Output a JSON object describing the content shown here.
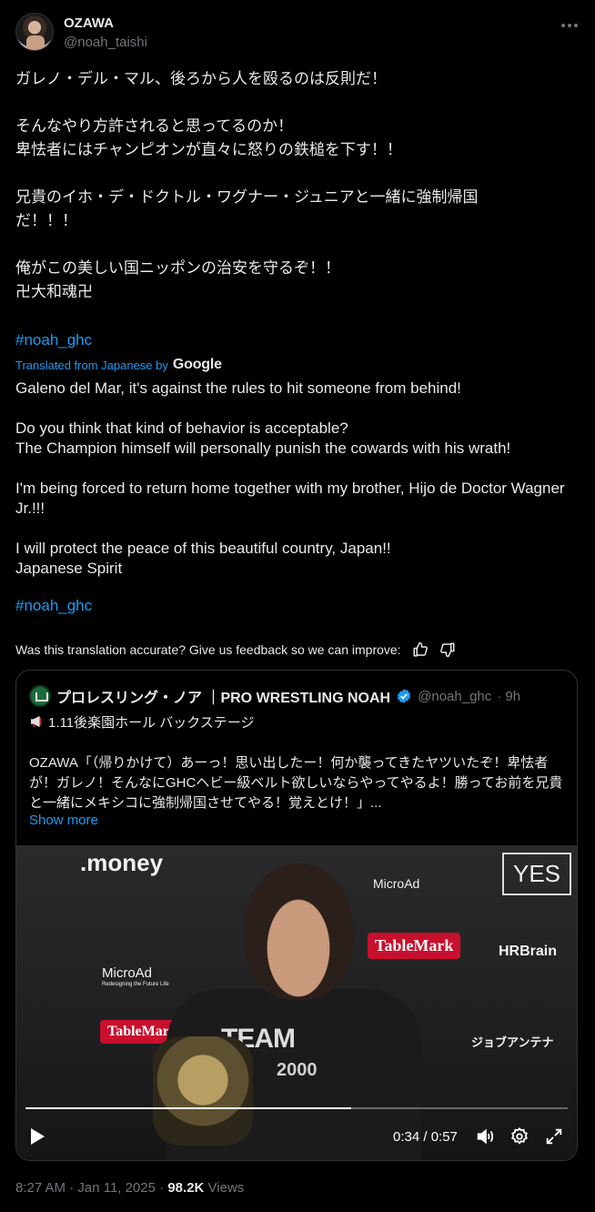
{
  "author": {
    "display_name": "OZAWA",
    "handle": "@noah_taishi"
  },
  "tweet": {
    "text_ja": "ガレノ・デル・マル、後ろから人を殴るのは反則だ！\n\nそんなやり方許されると思ってるのか！\n卑怯者にはチャンピオンが直々に怒りの鉄槌を下す！！\n\n兄貴のイホ・デ・ドクトル・ワグナー・ジュニアと一緒に強制帰国\nだ！！！\n\n俺がこの美しい国ニッポンの治安を守るぞ！！\n卍大和魂卍",
    "hashtag": "#noah_ghc",
    "translated_label": "Translated from Japanese by",
    "translator": "Google",
    "text_en": "Galeno del Mar, it's against the rules to hit someone from behind!\n\nDo you think that kind of behavior is acceptable?\nThe Champion himself will personally punish the cowards with his wrath!\n\nI'm being forced to return home together with my brother, Hijo de Doctor Wagner Jr.!!!\n\nI will protect the peace of this beautiful country, Japan!!\nJapanese Spirit",
    "hashtag_en": "#noah_ghc",
    "feedback_prompt": "Was this translation accurate? Give us feedback so we can improve:"
  },
  "quote": {
    "name": "プロレスリング・ノア ｜PRO WRESTLING NOAH",
    "handle": "@noah_ghc",
    "time": "· 9h",
    "title_line": "1.11後楽園ホール バックステージ",
    "body": "OZAWA「（帰りかけて）あーっ！思い出したー！何か襲ってきたヤツいたぞ！卑怯者が！ガレノ！そんなにGHCヘビー級ベルト欲しいならやってやるよ！勝ってお前を兄貴と一緒にメキシコに強制帰国させてやる！覚えとけ！」...",
    "show_more": "Show more",
    "video": {
      "time_display": "0:34 / 0:57",
      "progress": 0.6,
      "backdrop_logos": [
        ".money",
        "MicroAd",
        "YES",
        "TableMark",
        "HRBrain",
        "MicroAd",
        "TableMark",
        "ジョブアンテナ",
        "Redesigning the Future Life",
        "TEAM",
        "2000"
      ]
    }
  },
  "meta": {
    "time": "8:27 AM · Jan 11, 2025",
    "separator": "·",
    "views_count": "98.2K",
    "views_label": "Views"
  },
  "icons": [
    "more-icon",
    "thumbs-up-icon",
    "thumbs-down-icon",
    "verified-badge-icon",
    "megaphone-icon",
    "play-icon",
    "volume-icon",
    "settings-icon",
    "fullscreen-icon"
  ],
  "colors": {
    "background": "#000000",
    "text": "#e7e9ea",
    "muted": "#71767b",
    "link": "#1d9bf0",
    "border": "#2f3336"
  }
}
